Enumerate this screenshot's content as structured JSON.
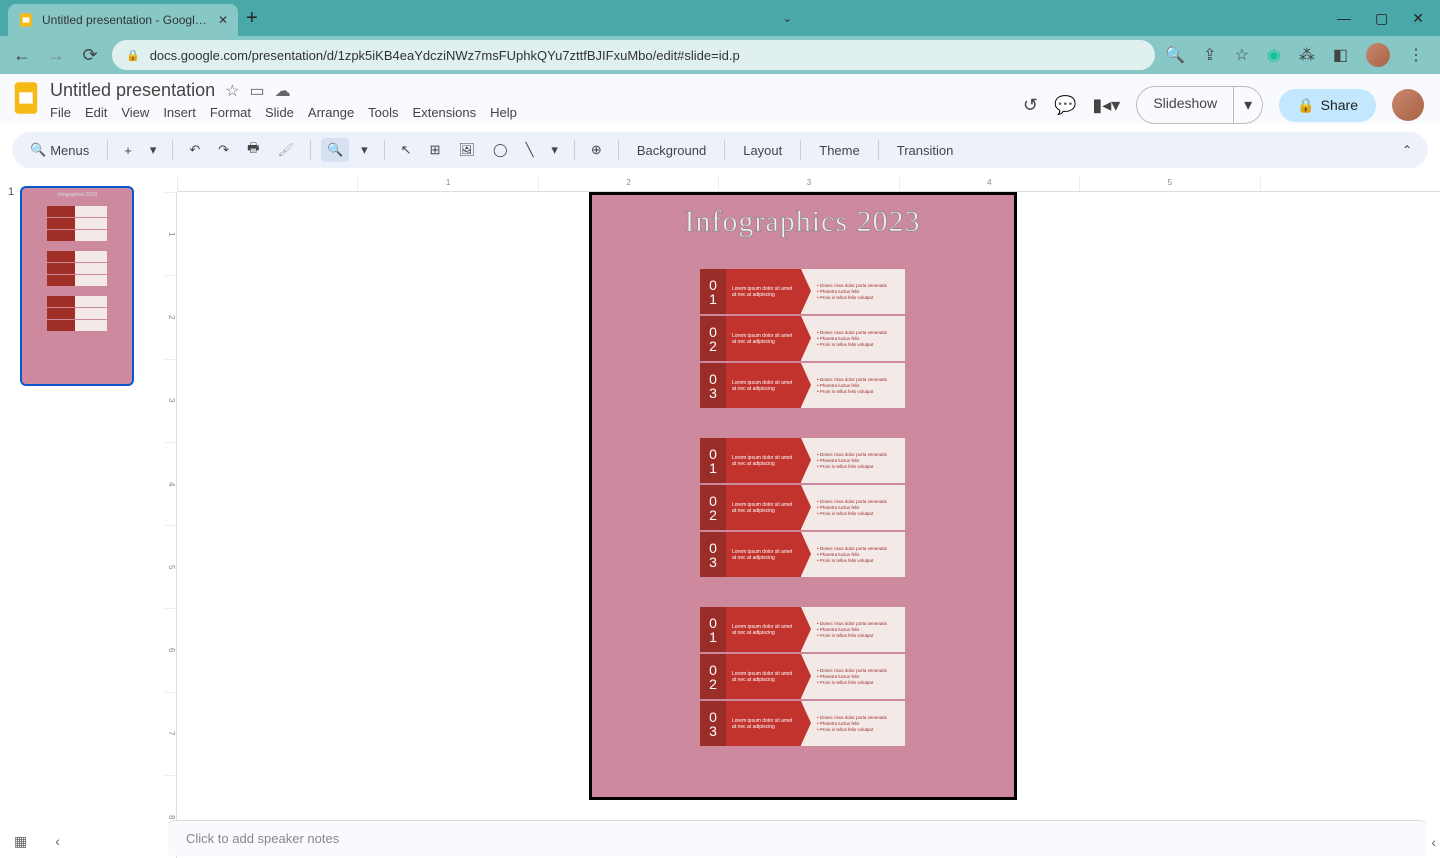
{
  "browser": {
    "tab_title": "Untitled presentation - Google Slides",
    "url": "docs.google.com/presentation/d/1zpk5iKB4eaYdcziNWz7msFUphkQYu7zttfBJIFxuMbo/edit#slide=id.p"
  },
  "header": {
    "doc_title": "Untitled presentation",
    "menus": [
      "File",
      "Edit",
      "View",
      "Insert",
      "Format",
      "Slide",
      "Arrange",
      "Tools",
      "Extensions",
      "Help"
    ],
    "slideshow": "Slideshow",
    "share": "Share"
  },
  "toolbar": {
    "search_placeholder": "Menus",
    "background": "Background",
    "layout": "Layout",
    "theme": "Theme",
    "transition": "Transition"
  },
  "thumb": {
    "number": "1",
    "title": "Infographics 2023"
  },
  "slide": {
    "title": "Infographics 2023",
    "groups": [
      {
        "rows": [
          {
            "num_top": "0",
            "num_bot": "1",
            "arrow_text": "Lorem ipsum dolor sit amet at nec at adipiscing",
            "bullets": [
              "Donec risus dolor porta venenatis",
              "Pharetra luctus felis",
              "Proin in tellus felis volutpat"
            ]
          },
          {
            "num_top": "0",
            "num_bot": "2",
            "arrow_text": "Lorem ipsum dolor sit amet at nec at adipiscing",
            "bullets": [
              "Donec risus dolor porta venenatis",
              "Pharetra luctus felis",
              "Proin in tellus felis volutpat"
            ]
          },
          {
            "num_top": "0",
            "num_bot": "3",
            "arrow_text": "Lorem ipsum dolor sit amet at nec at adipiscing",
            "bullets": [
              "Donec risus dolor porta venenatis",
              "Pharetra luctus felis",
              "Proin in tellus felis volutpat"
            ]
          }
        ]
      },
      {
        "rows": [
          {
            "num_top": "0",
            "num_bot": "1",
            "arrow_text": "Lorem ipsum dolor sit amet at nec at adipiscing",
            "bullets": [
              "Donec risus dolor porta venenatis",
              "Pharetra luctus felis",
              "Proin in tellus felis volutpat"
            ]
          },
          {
            "num_top": "0",
            "num_bot": "2",
            "arrow_text": "Lorem ipsum dolor sit amet at nec at adipiscing",
            "bullets": [
              "Donec risus dolor porta venenatis",
              "Pharetra luctus felis",
              "Proin in tellus felis volutpat"
            ]
          },
          {
            "num_top": "0",
            "num_bot": "3",
            "arrow_text": "Lorem ipsum dolor sit amet at nec at adipiscing",
            "bullets": [
              "Donec risus dolor porta venenatis",
              "Pharetra luctus felis",
              "Proin in tellus felis volutpat"
            ]
          }
        ]
      },
      {
        "rows": [
          {
            "num_top": "0",
            "num_bot": "1",
            "arrow_text": "Lorem ipsum dolor sit amet at nec at adipiscing",
            "bullets": [
              "Donec risus dolor porta venenatis",
              "Pharetra luctus felis",
              "Proin in tellus felis volutpat"
            ]
          },
          {
            "num_top": "0",
            "num_bot": "2",
            "arrow_text": "Lorem ipsum dolor sit amet at nec at adipiscing",
            "bullets": [
              "Donec risus dolor porta venenatis",
              "Pharetra luctus felis",
              "Proin in tellus felis volutpat"
            ]
          },
          {
            "num_top": "0",
            "num_bot": "3",
            "arrow_text": "Lorem ipsum dolor sit amet at nec at adipiscing",
            "bullets": [
              "Donec risus dolor porta venenatis",
              "Pharetra luctus felis",
              "Proin in tellus felis volutpat"
            ]
          }
        ]
      }
    ]
  },
  "ruler": {
    "h": [
      "",
      "1",
      "2",
      "3",
      "4",
      "5",
      ""
    ],
    "v": [
      "1",
      "2",
      "3",
      "4",
      "5",
      "6",
      "7",
      "8"
    ]
  },
  "notes": {
    "placeholder": "Click to add speaker notes"
  }
}
